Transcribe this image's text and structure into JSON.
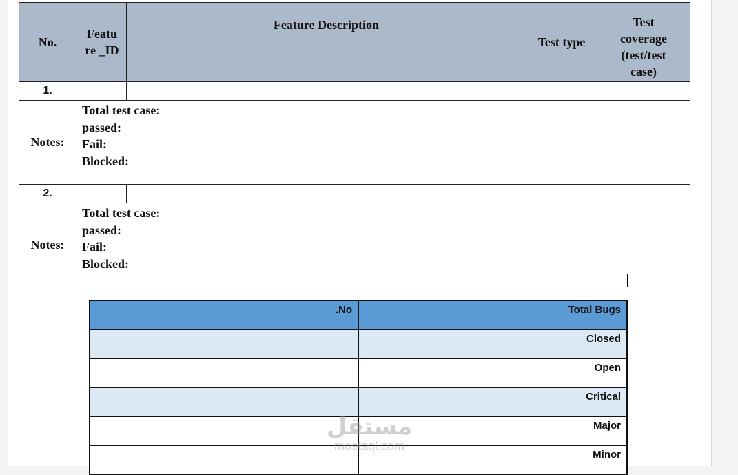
{
  "top_table": {
    "headers": {
      "no": "No.",
      "feature_id_line1": "Featu",
      "feature_id_line2": "re _ID",
      "description": "Feature Description",
      "test_type": "Test type",
      "coverage_line1": "Test",
      "coverage_line2": "coverage",
      "coverage_line3": "(test/test",
      "coverage_line4": "case)"
    },
    "rows": [
      {
        "number": "1.",
        "notes_label": "Notes:",
        "notes": [
          "Total test case:",
          "passed:",
          "Fail:",
          "Blocked:"
        ]
      },
      {
        "number": "2.",
        "notes_label": "Notes:",
        "notes": [
          "Total test case:",
          "passed:",
          "Fail:",
          "Blocked:"
        ]
      }
    ]
  },
  "bugs_table": {
    "header": {
      "no": ".No",
      "total": "Total Bugs"
    },
    "rows": [
      {
        "label": "Closed",
        "value": ""
      },
      {
        "label": "Open",
        "value": ""
      },
      {
        "label": "Critical",
        "value": ""
      },
      {
        "label": "Major",
        "value": ""
      },
      {
        "label": "Minor",
        "value": ""
      }
    ]
  },
  "watermark": {
    "arabic": "مستقل",
    "latin": "mostaql.com"
  },
  "colors": {
    "top_header_bg": "#acb9ca",
    "bugs_header_bg": "#5b9bd5",
    "bugs_band_bg": "#dde8f5"
  }
}
